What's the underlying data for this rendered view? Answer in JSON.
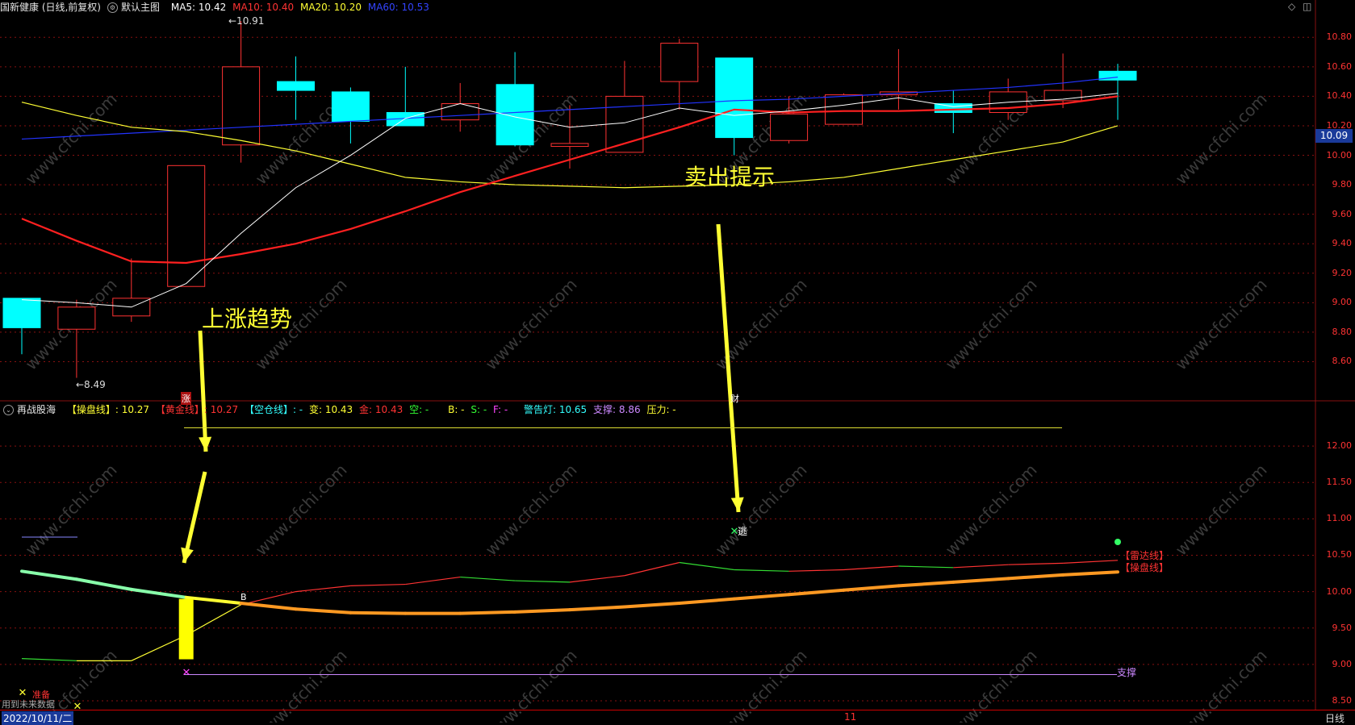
{
  "header": {
    "stock": "国新健康 (日线,前复权)",
    "layout": "默认主图",
    "ma5": "MA5: 10.42",
    "ma10": "MA10: 10.40",
    "ma20": "MA20: 10.20",
    "ma60": "MA60: 10.53"
  },
  "colors": {
    "up": "#ff3232",
    "down": "#00ffff",
    "ma5": "#ffffff",
    "ma10": "#ff2020",
    "ma20": "#ffff33",
    "ma60": "#2233ff",
    "grid": "#881111"
  },
  "main_axis": {
    "min": 8.4,
    "max": 10.9,
    "ticks": [
      "10.80",
      "10.60",
      "10.40",
      "10.20",
      "10.00",
      "9.80",
      "9.60",
      "9.40",
      "9.20",
      "9.00",
      "8.80",
      "8.60"
    ],
    "current": "10.09"
  },
  "candles": [
    {
      "o": 9.03,
      "c": 8.83,
      "h": 9.03,
      "l": 8.65
    },
    {
      "o": 8.82,
      "c": 8.97,
      "h": 9.02,
      "l": 8.49
    },
    {
      "o": 8.91,
      "c": 9.03,
      "h": 9.3,
      "l": 8.87
    },
    {
      "o": 9.11,
      "c": 9.93,
      "h": 9.93,
      "l": 9.11
    },
    {
      "o": 10.07,
      "c": 10.6,
      "h": 10.91,
      "l": 9.95
    },
    {
      "o": 10.5,
      "c": 10.44,
      "h": 10.67,
      "l": 10.24
    },
    {
      "o": 10.43,
      "c": 10.23,
      "h": 10.46,
      "l": 10.08
    },
    {
      "o": 10.29,
      "c": 10.2,
      "h": 10.6,
      "l": 10.2
    },
    {
      "o": 10.24,
      "c": 10.35,
      "h": 10.49,
      "l": 10.16
    },
    {
      "o": 10.48,
      "c": 10.07,
      "h": 10.7,
      "l": 10.06
    },
    {
      "o": 10.06,
      "c": 10.08,
      "h": 10.34,
      "l": 9.91
    },
    {
      "o": 10.02,
      "c": 10.4,
      "h": 10.64,
      "l": 10.02
    },
    {
      "o": 10.5,
      "c": 10.76,
      "h": 10.79,
      "l": 10.31
    },
    {
      "o": 10.66,
      "c": 10.12,
      "h": 10.66,
      "l": 10.0
    },
    {
      "o": 10.1,
      "c": 10.28,
      "h": 10.4,
      "l": 10.08
    },
    {
      "o": 10.21,
      "c": 10.41,
      "h": 10.42,
      "l": 10.21
    },
    {
      "o": 10.41,
      "c": 10.43,
      "h": 10.72,
      "l": 10.31
    },
    {
      "o": 10.35,
      "c": 10.29,
      "h": 10.44,
      "l": 10.15
    },
    {
      "o": 10.29,
      "c": 10.43,
      "h": 10.52,
      "l": 10.24
    },
    {
      "o": 10.37,
      "c": 10.44,
      "h": 10.69,
      "l": 10.32
    },
    {
      "o": 10.57,
      "c": 10.51,
      "h": 10.62,
      "l": 10.24
    }
  ],
  "ma_lines": {
    "ma5": [
      9.02,
      9.0,
      8.97,
      9.13,
      9.47,
      9.78,
      10.0,
      10.25,
      10.35,
      10.26,
      10.19,
      10.22,
      10.32,
      10.27,
      10.3,
      10.34,
      10.39,
      10.33,
      10.36,
      10.38,
      10.42
    ],
    "ma10": [
      9.57,
      9.42,
      9.28,
      9.27,
      9.33,
      9.4,
      9.5,
      9.62,
      9.75,
      9.86,
      9.97,
      10.08,
      10.19,
      10.31,
      10.29,
      10.3,
      10.3,
      10.31,
      10.32,
      10.35,
      10.4
    ],
    "ma20": [
      10.36,
      10.27,
      10.19,
      10.16,
      10.1,
      10.03,
      9.94,
      9.85,
      9.82,
      9.8,
      9.79,
      9.78,
      9.79,
      9.8,
      9.82,
      9.85,
      9.91,
      9.97,
      10.03,
      10.09,
      10.2
    ],
    "ma60": [
      10.11,
      10.13,
      10.15,
      10.17,
      10.19,
      10.21,
      10.23,
      10.25,
      10.27,
      10.29,
      10.31,
      10.33,
      10.35,
      10.37,
      10.38,
      10.4,
      10.42,
      10.44,
      10.46,
      10.49,
      10.53
    ]
  },
  "price_labels": {
    "high": "←10.91",
    "low": "←8.49"
  },
  "annotations": {
    "rise": "上涨趋势",
    "sell": "卖出提示"
  },
  "markers": {
    "zhang": "涨",
    "cai": "财"
  },
  "sub": {
    "name": "再战股海",
    "cpx": "【操盘线】: 10.27",
    "hjx": "【黄金线】: 10.27",
    "kcx": "【空仓线】: -",
    "bian": "变: 10.43",
    "jin": "金: 10.43",
    "kong": "空: -",
    "b": "B: -",
    "s": "S: -",
    "f": "F: -",
    "jgd": "警告灯: 10.65",
    "zc": "支撑: 8.86",
    "yl": "压力: -",
    "label_radar": "【雷达线】",
    "label_cpx": "【操盘线】",
    "label_support": "支撑",
    "label_escape": "逃",
    "label_prepare": "准备",
    "label_b": "B",
    "top_line": 12.25,
    "support": 8.86
  },
  "sub_axis": {
    "min": 8.4,
    "max": 12.4,
    "ticks": [
      "12.00",
      "11.50",
      "11.00",
      "10.50",
      "10.00",
      "9.50",
      "9.00",
      "8.50"
    ]
  },
  "sub_series": {
    "op_line": [
      10.28,
      10.17,
      10.03,
      9.92,
      9.84,
      9.76,
      9.71,
      9.7,
      9.7,
      9.72,
      9.75,
      9.79,
      9.84,
      9.9,
      9.96,
      10.02,
      10.08,
      10.13,
      10.18,
      10.23,
      10.27
    ],
    "radar": [
      9.08,
      9.05,
      9.05,
      9.4,
      9.82,
      10.0,
      10.08,
      10.1,
      10.2,
      10.15,
      10.13,
      10.22,
      10.4,
      10.3,
      10.28,
      10.3,
      10.35,
      10.33,
      10.37,
      10.39,
      10.43
    ]
  },
  "footer": {
    "note": "用到未来数据",
    "date": "2022/10/11/二",
    "mid": "11",
    "period": "日线"
  }
}
